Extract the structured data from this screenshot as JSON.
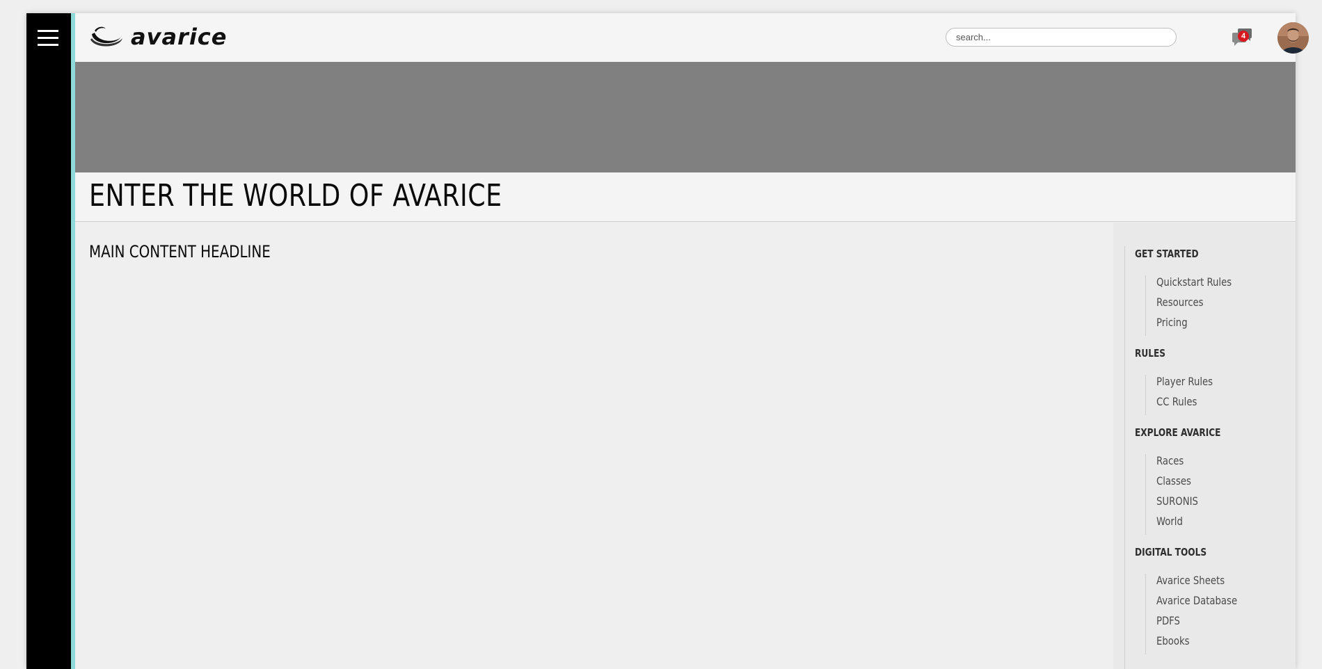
{
  "colors": {
    "rail": "#000000",
    "accent": "#8fd9d9",
    "hero": "#808080",
    "badge": "#d7191f"
  },
  "header": {
    "menu_icon": "hamburger-menu-icon",
    "logo_text": "avarice",
    "search_placeholder": "search...",
    "chat_icon": "chat-bubbles-icon",
    "notification_count": "4",
    "avatar_icon": "user-avatar"
  },
  "page": {
    "title": "ENTER THE WORLD OF AVARICE",
    "headline": "MAIN CONTENT HEADLINE"
  },
  "sidebar": {
    "sections": [
      {
        "heading": "GET STARTED",
        "items": [
          "Quickstart Rules",
          "Resources",
          "Pricing"
        ]
      },
      {
        "heading": "RULES",
        "items": [
          "Player Rules",
          "CC Rules"
        ]
      },
      {
        "heading": "EXPLORE AVARICE",
        "items": [
          "Races",
          "Classes",
          "SURONIS",
          "World"
        ]
      },
      {
        "heading": "DIGITAL TOOLS",
        "items": [
          "Avarice Sheets",
          "Avarice Database",
          "PDFS",
          "Ebooks"
        ]
      }
    ]
  }
}
